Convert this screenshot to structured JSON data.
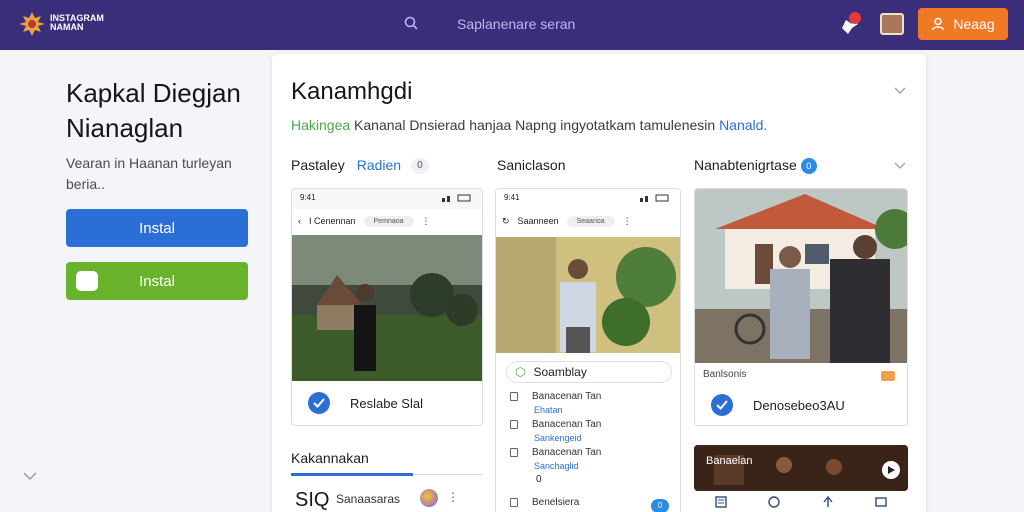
{
  "topbar": {
    "logo_text": "INSTAGRAM NAMAN",
    "search_placeholder": "Saplanenare seran",
    "cta_label": "Neaag",
    "notif_count": "1"
  },
  "hero": {
    "title": "Kapkal Diegjan Nianaglan",
    "subtitle": "Vearan in Haanan turleyan beria..",
    "btn_primary": "Instal",
    "btn_secondary": "Instal"
  },
  "panel": {
    "title": "Kanamhgdi",
    "desc_green": "Hakingea",
    "desc_main": " Kananal Dnsierad hanjaa Napng ingyotatkam tamulenesin ",
    "desc_blue": "Nanald.",
    "columns": [
      {
        "heading": "Pastaley",
        "link": "Radien",
        "pill": "0",
        "status_time": "9:41",
        "address": "I Cenennan",
        "address_pill": "Pemnaoa",
        "check_label": "Reslabe Slal"
      },
      {
        "heading": "Saniclason",
        "status_time": "9:41",
        "address": "Saanneen",
        "address_pill": "Seaanoa",
        "search_label": "Soamblay",
        "list": [
          {
            "title": "Banacenan Tan",
            "sub": "Ehatan"
          },
          {
            "title": "Banacenan Tan",
            "sub": "Sankengeid"
          },
          {
            "title": "Banacenan Tan",
            "sub": "Sanchaglid"
          },
          {
            "title": "Benelsiera",
            "sub": ""
          }
        ],
        "badge_1": "0",
        "badge_2": "0"
      },
      {
        "heading": "Nanabtenigrtase",
        "count": "0",
        "meta": "Banlsonis",
        "check_label": "Denosebeo3AU",
        "video_label": "Banaelan"
      }
    ],
    "tab_label": "Kakannakan",
    "ticker_value": "SIQ",
    "ticker_name": "Sanaasaras"
  },
  "colors": {
    "topbar": "#3a2d7a",
    "accent_orange": "#f07a23",
    "primary_blue": "#2b6fd6",
    "success_green": "#68b32b"
  }
}
